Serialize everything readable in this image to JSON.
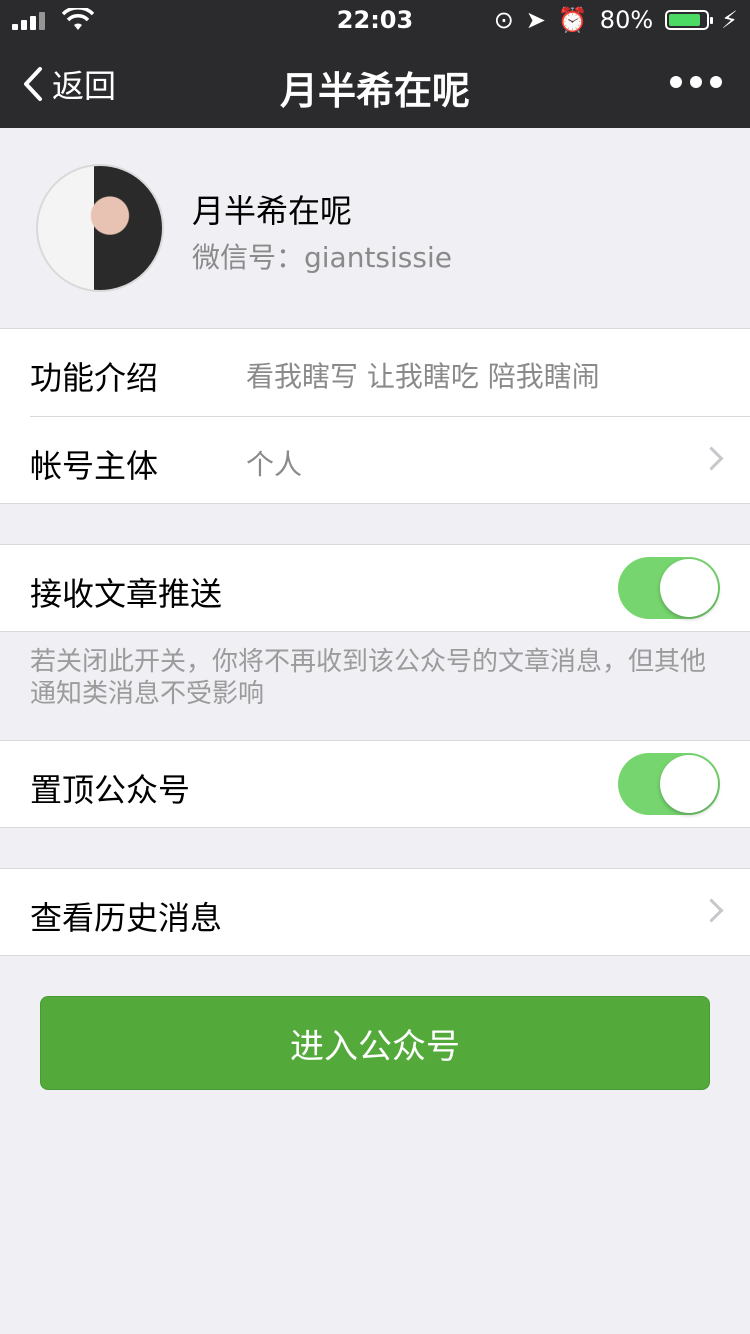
{
  "status_bar": {
    "time": "22:03",
    "battery_percent": "80%",
    "battery_level": 0.8
  },
  "nav": {
    "back_label": "返回",
    "title": "月半希在呢",
    "more_icon": "more-dots-icon"
  },
  "profile": {
    "name": "月半希在呢",
    "wechat_id": "微信号：giantsissie"
  },
  "info_group": {
    "items": [
      {
        "label": "功能介绍",
        "value": "看我瞎写 让我瞎吃 陪我瞎闹"
      },
      {
        "label": "帐号主体",
        "value": "个人"
      }
    ]
  },
  "settings": {
    "receive_push": {
      "label": "接收文章推送",
      "on": true
    },
    "hint": "若关闭此开关，你将不再收到该公众号的文章消息，但其他通知类消息不受影响",
    "pin_top": {
      "label": "置顶公众号",
      "on": true
    },
    "history": {
      "label": "查看历史消息"
    }
  },
  "primary_button": {
    "label": "进入公众号"
  },
  "colors": {
    "nav_bg": "#2b2b2d",
    "page_bg": "#efeff4",
    "toggle_on": "#76d56e",
    "primary": "#53aa3a"
  }
}
